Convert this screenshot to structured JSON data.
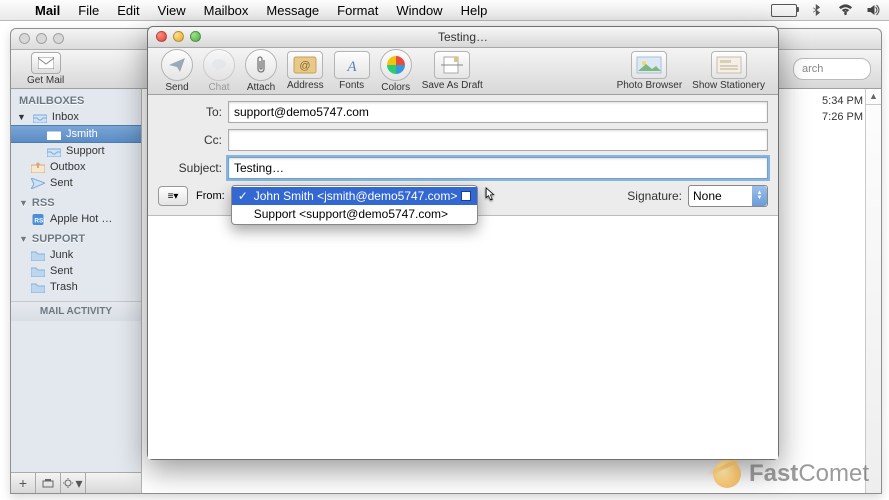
{
  "menubar": {
    "app": "Mail",
    "items": [
      "File",
      "Edit",
      "View",
      "Mailbox",
      "Message",
      "Format",
      "Window",
      "Help"
    ]
  },
  "mail_window": {
    "toolbar": {
      "get_mail": "Get Mail"
    },
    "sidebar": {
      "mailboxes_header": "MAILBOXES",
      "inbox": "Inbox",
      "jsmith": "Jsmith",
      "support": "Support",
      "outbox": "Outbox",
      "sent": "Sent",
      "rss_header": "RSS",
      "apple_hot": "Apple Hot …",
      "support_header": "SUPPORT",
      "junk": "Junk",
      "sent_folder": "Sent",
      "trash": "Trash",
      "activity": "MAIL ACTIVITY"
    },
    "messages": {
      "t1": "5:34 PM",
      "t2": "7:26 PM"
    },
    "search_placeholder": "arch"
  },
  "compose": {
    "title": "Testing…",
    "toolbar": {
      "send": "Send",
      "chat": "Chat",
      "attach": "Attach",
      "address": "Address",
      "fonts": "Fonts",
      "colors": "Colors",
      "draft": "Save As Draft",
      "photo": "Photo Browser",
      "stationery": "Show Stationery"
    },
    "labels": {
      "to": "To:",
      "cc": "Cc:",
      "subject": "Subject:",
      "from": "From:",
      "signature": "Signature:"
    },
    "values": {
      "to": "support@demo5747.com",
      "cc": "",
      "subject": "Testing…",
      "signature": "None"
    },
    "from_options": [
      "John Smith <jsmith@demo5747.com>",
      "Support <support@demo5747.com>"
    ],
    "options_glyph": "≡▾"
  },
  "watermark": {
    "brand_a": "Fast",
    "brand_b": "Comet"
  }
}
